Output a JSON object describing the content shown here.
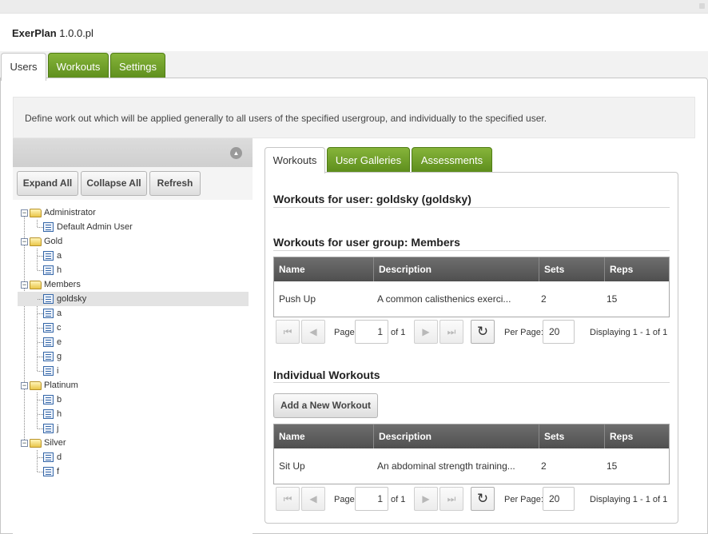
{
  "app": {
    "name": "ExerPlan",
    "version": "1.0.0.pl"
  },
  "main_tabs": [
    {
      "label": "Users",
      "active": true
    },
    {
      "label": "Workouts",
      "active": false
    },
    {
      "label": "Settings",
      "active": false
    }
  ],
  "description": "Define work out which will be applied generally to all users of the specified usergroup, and individually to the specified user.",
  "tree_toolbar": {
    "expand_all": "Expand All",
    "collapse_all": "Collapse All",
    "refresh": "Refresh"
  },
  "tree": {
    "groups": [
      {
        "label": "Administrator",
        "children": [
          "Default Admin User"
        ]
      },
      {
        "label": "Gold",
        "children": [
          "a",
          "h"
        ]
      },
      {
        "label": "Members",
        "children": [
          "goldsky",
          "a",
          "c",
          "e",
          "g",
          "i"
        ]
      },
      {
        "label": "Platinum",
        "children": [
          "b",
          "h",
          "j"
        ]
      },
      {
        "label": "Silver",
        "children": [
          "d",
          "f"
        ]
      }
    ],
    "selected": "goldsky"
  },
  "inner_tabs": [
    {
      "label": "Workouts",
      "active": true
    },
    {
      "label": "User Galleries",
      "active": false
    },
    {
      "label": "Assessments",
      "active": false
    }
  ],
  "user_workouts_title": "Workouts for user: goldsky (goldsky)",
  "group_workouts": {
    "title": "Workouts for user group: Members",
    "columns": [
      "Name",
      "Description",
      "Sets",
      "Reps"
    ],
    "rows": [
      {
        "name": "Push Up",
        "description": "A common calisthenics exerci...",
        "sets": "2",
        "reps": "15"
      }
    ],
    "pager": {
      "page_label": "Page",
      "page": "1",
      "of_label": "of 1",
      "per_page_label": "Per Page:",
      "per_page": "20",
      "display": "Displaying 1 - 1 of 1"
    }
  },
  "individual_workouts": {
    "title": "Individual Workouts",
    "add_button": "Add a New Workout",
    "columns": [
      "Name",
      "Description",
      "Sets",
      "Reps"
    ],
    "rows": [
      {
        "name": "Sit Up",
        "description": "An abdominal strength training...",
        "sets": "2",
        "reps": "15"
      }
    ],
    "pager": {
      "page_label": "Page",
      "page": "1",
      "of_label": "of 1",
      "per_page_label": "Per Page:",
      "per_page": "20",
      "display": "Displaying 1 - 1 of 1"
    }
  },
  "icons": {
    "first": "first-page-icon",
    "prev": "prev-page-icon",
    "next": "next-page-icon",
    "last": "last-page-icon",
    "refresh": "refresh-icon",
    "collapse": "collapse-up-icon",
    "folder": "folder-icon",
    "user": "user-record-icon"
  },
  "colors": {
    "tab_green": "#6f9f26",
    "grid_header": "#5c5c5c",
    "selected_row": "#e3e3e3"
  }
}
